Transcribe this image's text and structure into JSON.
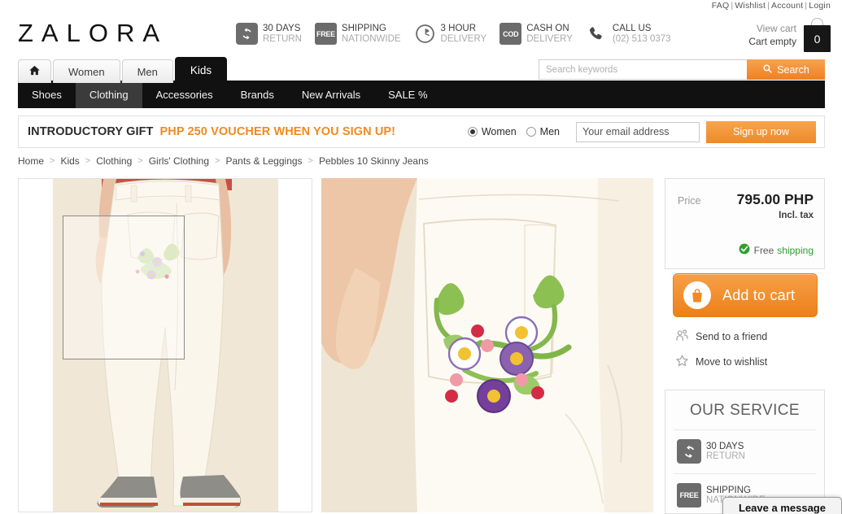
{
  "utility": {
    "links": [
      "FAQ",
      "Wishlist",
      "Account",
      "Login"
    ],
    "separator": "|"
  },
  "header": {
    "logo": "ZALORA",
    "usps": [
      {
        "badge_icon": "refresh-icon",
        "badge_text": "",
        "line1": "30 DAYS",
        "line2": "RETURN"
      },
      {
        "badge_icon": "free-badge",
        "badge_text": "FREE",
        "line1": "SHIPPING",
        "line2": "NATIONWIDE"
      },
      {
        "badge_icon": "clock-icon",
        "badge_text": "",
        "line1": "3 HOUR",
        "line2": "DELIVERY"
      },
      {
        "badge_icon": "cod-badge",
        "badge_text": "COD",
        "line1": "CASH ON",
        "line2": "DELIVERY"
      },
      {
        "badge_icon": "phone-icon",
        "badge_text": "",
        "line1": "CALL US",
        "line2": "(02) 513 0373"
      }
    ],
    "cart": {
      "view_label": "View cart",
      "status_label": "Cart empty",
      "count": "0",
      "icon": "shopping-bag-icon"
    }
  },
  "nav": {
    "tabs": [
      {
        "label": "",
        "icon": "home-icon",
        "active": false
      },
      {
        "label": "Women",
        "active": false
      },
      {
        "label": "Men",
        "active": false
      },
      {
        "label": "Kids",
        "active": true
      }
    ],
    "subnav": [
      {
        "label": "Shoes",
        "active": false
      },
      {
        "label": "Clothing",
        "active": true
      },
      {
        "label": "Accessories",
        "active": false
      },
      {
        "label": "Brands",
        "active": false
      },
      {
        "label": "New Arrivals",
        "active": false
      },
      {
        "label": "SALE %",
        "active": false
      }
    ]
  },
  "search": {
    "placeholder": "Search keywords",
    "value": "",
    "button_label": "Search",
    "icon": "search-icon"
  },
  "promo": {
    "title": "INTRODUCTORY GIFT",
    "subtitle": "PHP 250 VOUCHER WHEN YOU SIGN UP!",
    "radios": [
      {
        "label": "Women",
        "checked": true
      },
      {
        "label": "Men",
        "checked": false
      }
    ],
    "email_placeholder": "Your email address",
    "email_value": "",
    "button_label": "Sign up now",
    "accent_color": "#f08a1e"
  },
  "breadcrumb": {
    "separator": ">",
    "items": [
      "Home",
      "Kids",
      "Clothing",
      "Girls' Clothing",
      "Pants & Leggings",
      "Pebbles 10 Skinny Jeans"
    ]
  },
  "gallery": {
    "main_alt": "Pebbles 10 Skinny Jeans worn by child, back view",
    "zoom_alt": "Close-up of floral embroidery on back pocket"
  },
  "sidebar": {
    "price": {
      "label": "Price",
      "value": "795.00 PHP",
      "tax_note": "Incl. tax",
      "shipping_prefix": "Free",
      "shipping_highlight": "shipping",
      "shipping_color": "#2f9e2f",
      "check_icon": "check-circle-icon"
    },
    "add_to_cart": {
      "label": "Add to cart",
      "icon": "shopping-bag-icon",
      "color": "#ed8019"
    },
    "links": [
      {
        "label": "Send to a friend",
        "icon": "friends-icon"
      },
      {
        "label": "Move to wishlist",
        "icon": "star-icon"
      }
    ],
    "service": {
      "title": "OUR SERVICE",
      "items": [
        {
          "badge_icon": "refresh-icon",
          "badge_text": "",
          "line1": "30 DAYS",
          "line2": "RETURN"
        },
        {
          "badge_icon": "free-badge",
          "badge_text": "FREE",
          "line1": "SHIPPING",
          "line2": "NATIONWIDE"
        }
      ]
    }
  },
  "chat": {
    "label": "Leave a message"
  }
}
